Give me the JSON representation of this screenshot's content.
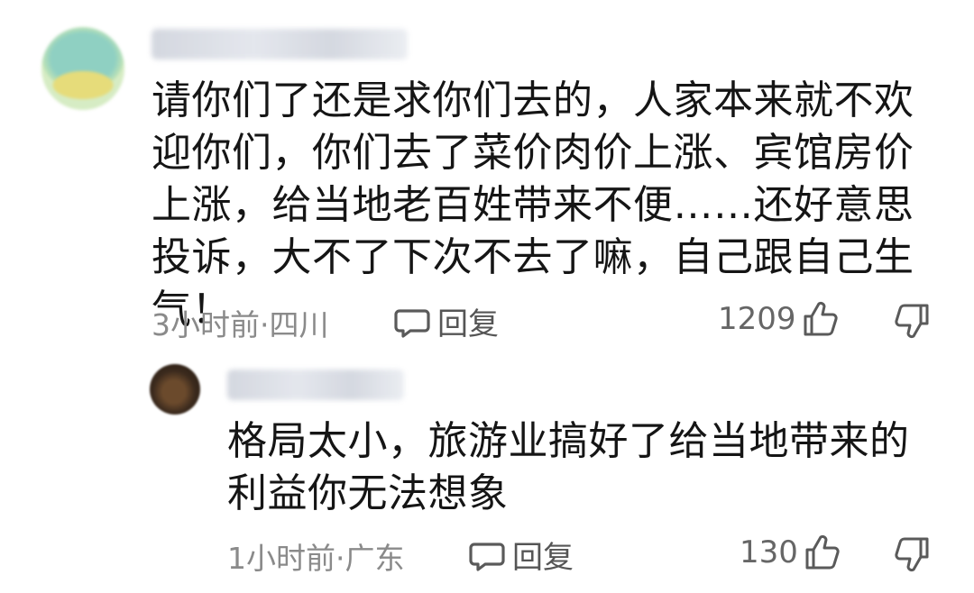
{
  "comments": [
    {
      "username": "",
      "text": "请你们了还是求你们去的，人家本来就不欢迎你们，你们去了菜价肉价上涨、宾馆房价上涨，给当地老百姓带来不便……还好意思投诉，大不了下次不去了嘛，自己跟自己生气！",
      "meta": "3小时前·四川",
      "reply_label": "回复",
      "likes": "1209"
    },
    {
      "username": "",
      "text": "格局太小，旅游业搞好了给当地带来的利益你无法想象",
      "meta": "1小时前·广东",
      "reply_label": "回复",
      "likes": "130"
    }
  ],
  "icons": {
    "reply": "speech-bubble-icon",
    "like": "thumbs-up-icon",
    "dislike": "thumbs-down-icon"
  },
  "colors": {
    "text": "#151515",
    "meta": "#8a8a8a",
    "icon": "#6b6b6b"
  }
}
